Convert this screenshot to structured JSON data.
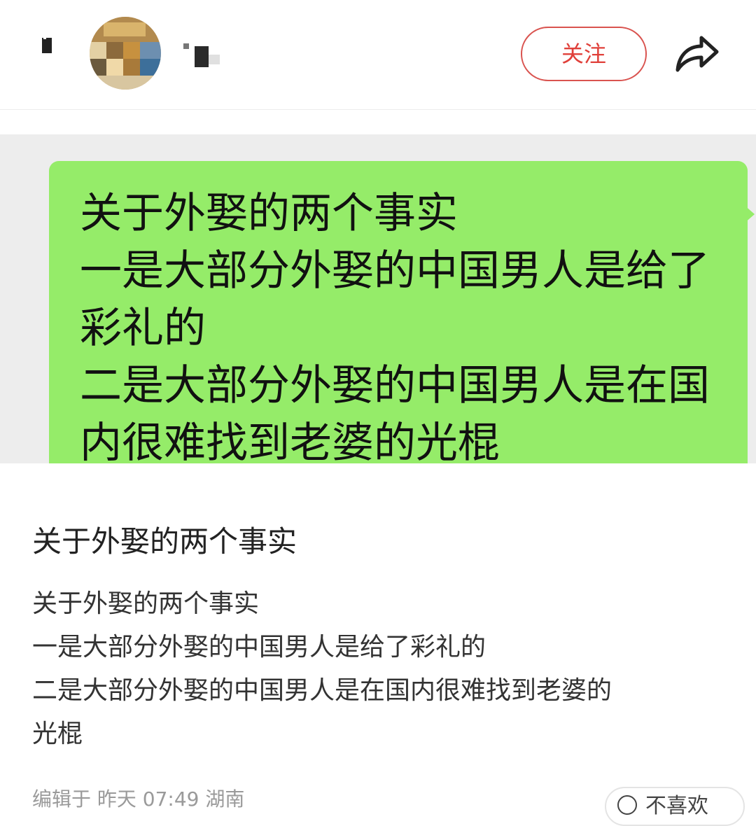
{
  "header": {
    "follow_label": "关注"
  },
  "image": {
    "bubble_lines": [
      "关于外娶的两个事实",
      "一是大部分外娶的中国男人是给了",
      "彩礼的",
      "二是大部分外娶的中国男人是在国",
      "内很难找到老婆的光棍"
    ]
  },
  "post": {
    "title": "关于外娶的两个事实",
    "body_lines": [
      "关于外娶的两个事实",
      "一是大部分外娶的中国男人是给了彩礼的",
      "二是大部分外娶的中国男人是在国内很难找到老婆的",
      "光棍"
    ],
    "meta": "编辑于 昨天 07:49 湖南",
    "dislike_label": "不喜欢"
  },
  "colors": {
    "accent": "#e0403a",
    "bubble": "#95ec69",
    "image_bg": "#ededed"
  },
  "icons": {
    "back": "back-icon",
    "share": "share-arrow-icon",
    "dislike": "dislike-icon"
  }
}
